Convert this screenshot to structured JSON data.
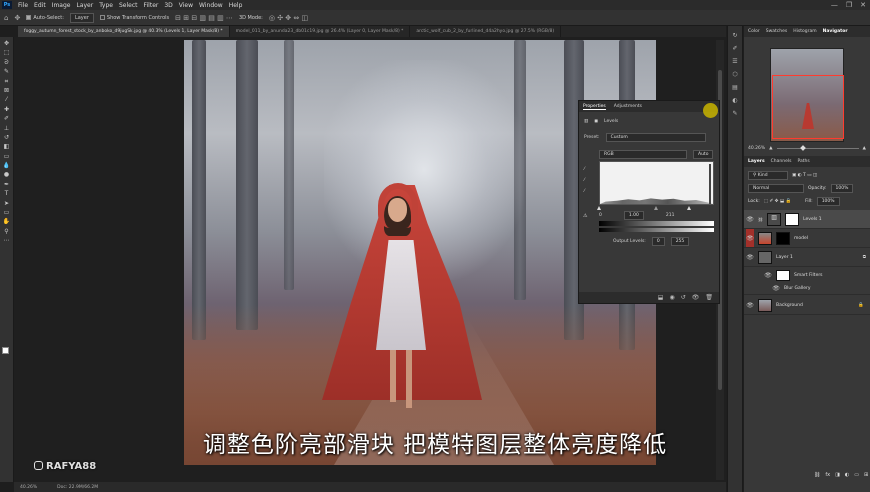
{
  "menu": {
    "logo": "Ps",
    "items": [
      "File",
      "Edit",
      "Image",
      "Layer",
      "Type",
      "Select",
      "Filter",
      "3D",
      "View",
      "Window",
      "Help"
    ],
    "controls": [
      "—",
      "❐",
      "✕"
    ]
  },
  "options_bar": {
    "auto_select_label": "Auto-Select:",
    "layer_select": "Layer",
    "transform_label": "Show Transform Controls",
    "mode_3d": "3D Mode:"
  },
  "doc_tabs": [
    "foggy_autumn_forest_stock_by_anboko_d9jugSk.jpg @ 40.3% (Levels 1, Layer Mask/8) *",
    "model_011_by_anunda23_db01c19.jpg @ 26.4% (Layer 0, Layer Mask/8) *",
    "arctic_wolf_cub_2_by_furlined_d4a2hyo.jpg @ 27.5% (RGB/8)"
  ],
  "subtitle": "调整色阶亮部滑块 把模特图层整体亮度降低",
  "watermark": "RAFYA88",
  "status": {
    "zoom": "40.26%",
    "doc": "Doc: 22.9M/66.2M"
  },
  "properties": {
    "tabs": [
      "Properties",
      "Adjustments"
    ],
    "layer_type": "Levels",
    "preset_label": "Preset:",
    "preset_value": "Custom",
    "channel": "RGB",
    "auto_label": "Auto",
    "input_black": "0",
    "input_gamma": "1.00",
    "input_white": "211",
    "output_label": "Output Levels:",
    "output_black": "0",
    "output_white": "255"
  },
  "right_panels": {
    "top_tabs": [
      "Color",
      "Swatches",
      "Histogram",
      "Navigator"
    ],
    "active_top_tab": "Navigator",
    "zoom": "40.26%",
    "layer_tabs": [
      "Layers",
      "Channels",
      "Paths"
    ],
    "kind_label": "Kind",
    "blend_mode": "Normal",
    "opacity_label": "Opacity:",
    "opacity_value": "100%",
    "lock_label": "Lock:",
    "fill_label": "Fill:",
    "fill_value": "100%",
    "layers": [
      {
        "name": "Levels 1"
      },
      {
        "name": "model"
      },
      {
        "name": "Layer 1"
      },
      {
        "name": "Smart Filters"
      },
      {
        "name": "Blur Gallery"
      },
      {
        "name": "Background"
      }
    ]
  }
}
